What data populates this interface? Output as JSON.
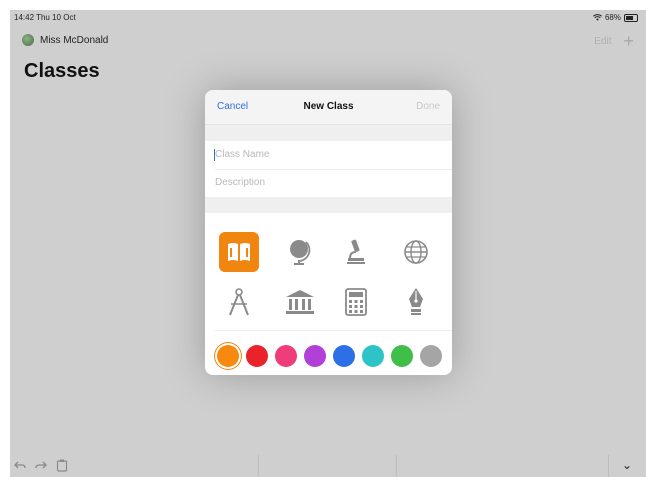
{
  "status": {
    "time": "14:42  Thu 10 Oct",
    "battery": "68%",
    "battery_level": 0.68
  },
  "nav": {
    "profile_name": "Miss McDonald",
    "edit_label": "Edit",
    "add_label": "+"
  },
  "page": {
    "title": "Classes"
  },
  "dialog": {
    "cancel_label": "Cancel",
    "title": "New Class",
    "done_label": "Done",
    "class_name_placeholder": "Class Name",
    "class_name_value": "",
    "description_placeholder": "Description",
    "description_value": "",
    "icons": [
      "book-icon",
      "globe-icon",
      "microscope-icon",
      "world-icon",
      "compass-icon",
      "museum-icon",
      "calculator-icon",
      "fountain-pen-icon"
    ],
    "selected_icon": "book-icon",
    "colors": [
      "#f7890e",
      "#e8232a",
      "#ef3d7b",
      "#b13fd8",
      "#2d6fe6",
      "#2ec4c7",
      "#3fbf4a",
      "#a5a5a5"
    ],
    "selected_color": "#f7890e"
  },
  "toolbar": {
    "undo_icon": "undo-icon",
    "redo_icon": "redo-icon",
    "clipboard_icon": "clipboard-icon",
    "chevron": "⌄"
  }
}
